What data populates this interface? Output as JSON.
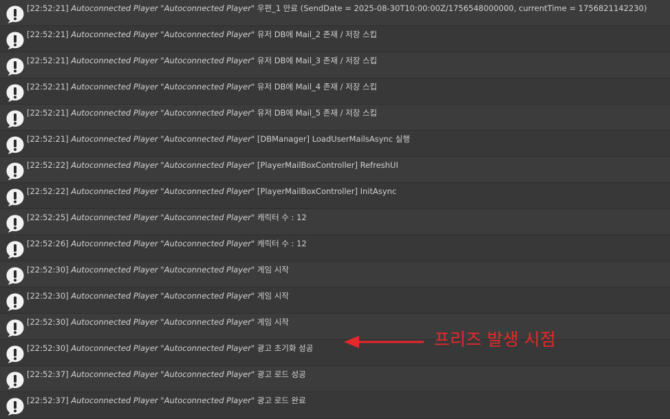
{
  "log": {
    "entries": [
      {
        "time": "[22:52:21]",
        "source": "Autoconnected Player \"Autoconnected Player\"",
        "message": "우편_1 만료 (SendDate = 2025-08-30T10:00:00Z/1756548000000, currentTime = 1756821142230)"
      },
      {
        "time": "[22:52:21]",
        "source": "Autoconnected Player \"Autoconnected Player\"",
        "message": "유저 DB에 Mail_2 존재 / 저장 스킵"
      },
      {
        "time": "[22:52:21]",
        "source": "Autoconnected Player \"Autoconnected Player\"",
        "message": "유저 DB에 Mail_3 존재 / 저장 스킵"
      },
      {
        "time": "[22:52:21]",
        "source": "Autoconnected Player \"Autoconnected Player\"",
        "message": "유저 DB에 Mail_4 존재 / 저장 스킵"
      },
      {
        "time": "[22:52:21]",
        "source": "Autoconnected Player \"Autoconnected Player\"",
        "message": "유저 DB에 Mail_5 존재 / 저장 스킵"
      },
      {
        "time": "[22:52:21]",
        "source": "Autoconnected Player \"Autoconnected Player\"",
        "message": "[DBManager] LoadUserMailsAsync 실행"
      },
      {
        "time": "[22:52:22]",
        "source": "Autoconnected Player \"Autoconnected Player\"",
        "message": "[PlayerMailBoxController] RefreshUI"
      },
      {
        "time": "[22:52:22]",
        "source": "Autoconnected Player \"Autoconnected Player\"",
        "message": "[PlayerMailBoxController] InitAsync"
      },
      {
        "time": "[22:52:25]",
        "source": "Autoconnected Player \"Autoconnected Player\"",
        "message": "캐릭터 수 : 12"
      },
      {
        "time": "[22:52:26]",
        "source": "Autoconnected Player \"Autoconnected Player\"",
        "message": "캐릭터 수 : 12"
      },
      {
        "time": "[22:52:30]",
        "source": "Autoconnected Player \"Autoconnected Player\"",
        "message": "게임 시작"
      },
      {
        "time": "[22:52:30]",
        "source": "Autoconnected Player \"Autoconnected Player\"",
        "message": "게임 시작"
      },
      {
        "time": "[22:52:30]",
        "source": "Autoconnected Player \"Autoconnected Player\"",
        "message": "게임 시작"
      },
      {
        "time": "[22:52:30]",
        "source": "Autoconnected Player \"Autoconnected Player\"",
        "message": "광고 초기화 성공"
      },
      {
        "time": "[22:52:37]",
        "source": "Autoconnected Player \"Autoconnected Player\"",
        "message": "광고 로드 성공"
      },
      {
        "time": "[22:52:37]",
        "source": "Autoconnected Player \"Autoconnected Player\"",
        "message": "광고 로드 완료"
      }
    ],
    "entry_icon": "info-speech-bubble-icon"
  },
  "annotation": {
    "label": "프리즈 발생 시점",
    "color": "#e8272b",
    "points_to_entry": 13
  },
  "colors": {
    "background": "#383838",
    "row_alt": "#3c3c3c",
    "text": "#d2d2d2"
  }
}
